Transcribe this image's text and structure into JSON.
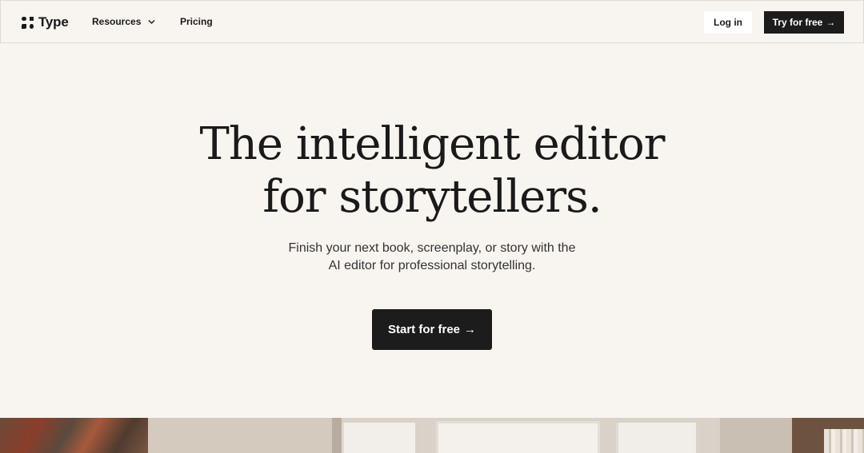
{
  "nav": {
    "logo_text": "Type",
    "logo_icon": "type-logo-icon",
    "links": [
      {
        "label": "Resources",
        "has_dropdown": true
      },
      {
        "label": "Pricing",
        "has_dropdown": false
      }
    ],
    "login_label": "Log in",
    "try_label": "Try for free",
    "try_arrow": "→"
  },
  "hero": {
    "title_line1": "The intelligent editor",
    "title_line2": "for storytellers.",
    "subtitle_line1": "Finish your next book, screenplay, or story with the",
    "subtitle_line2": "AI editor for professional storytelling.",
    "cta_label": "Start for free",
    "cta_arrow": "→"
  },
  "colors": {
    "background": "#f8f4f0",
    "button_dark": "#1c1c1c",
    "text": "#1a1a1a"
  }
}
